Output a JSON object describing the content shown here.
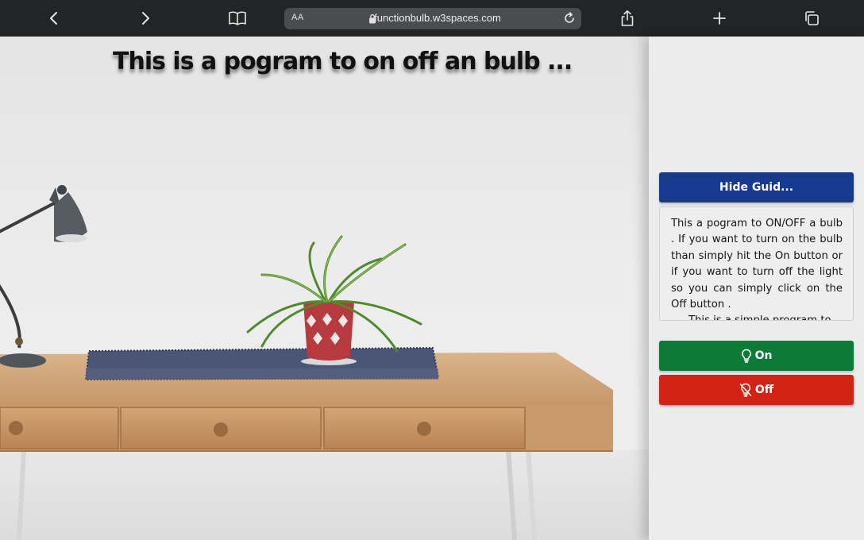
{
  "browser": {
    "text_size_label": "AA",
    "url": "functionbulb.w3spaces.com",
    "icons": [
      "back-icon",
      "forward-icon",
      "bookmarks-icon",
      "lock-icon",
      "reload-icon",
      "share-icon",
      "new-tab-icon",
      "tabs-icon"
    ],
    "colors": {
      "toolbar": "#222426",
      "address_bar": "#4a4c50"
    }
  },
  "page": {
    "title": "This is a pogram to on off an bulb ..."
  },
  "panel": {
    "hide_guide_label": "Hide Guid...",
    "guide_text": "This a pogram to ON/OFF a bulb . If you want to turn on the bulb than simply hit the On button or if you want to turn off the light so you can simply click on the Off button .",
    "guide_text_clipped": "This is a simple program to",
    "on_label": "On",
    "off_label": "Off",
    "on_icon": "lightbulb-icon",
    "off_icon": "lightbulb-off-icon",
    "colors": {
      "hide": "#153a8f",
      "on": "#0d7a38",
      "off": "#d32314",
      "panel": "#ececec"
    }
  }
}
